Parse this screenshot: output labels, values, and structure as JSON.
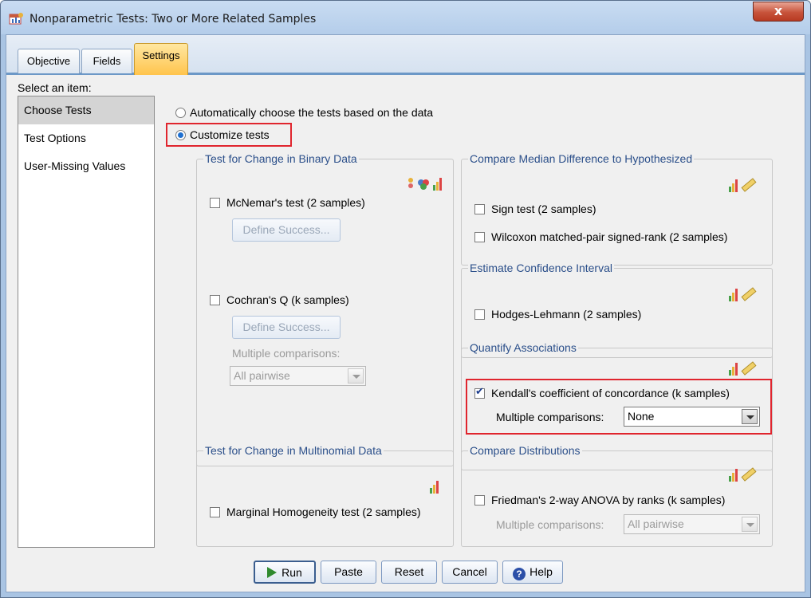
{
  "window": {
    "title": "Nonparametric Tests: Two or More Related Samples",
    "close_label": "x"
  },
  "tabs": [
    {
      "label": "Objective"
    },
    {
      "label": "Fields"
    },
    {
      "label": "Settings"
    }
  ],
  "sidebar": {
    "label": "Select an item:",
    "items": [
      {
        "label": "Choose Tests"
      },
      {
        "label": "Test Options"
      },
      {
        "label": "User-Missing Values"
      }
    ]
  },
  "mode": {
    "auto_label": "Automatically choose the tests based on the data",
    "custom_label": "Customize tests",
    "selected": "custom"
  },
  "binary": {
    "title": "Test for Change in Binary Data",
    "mcnemar": "McNemar's test (2 samples)",
    "define_success_1": "Define Success...",
    "cochran": "Cochran's Q (k samples)",
    "define_success_2": "Define Success...",
    "multiple_label": "Multiple comparisons:",
    "multiple_value": "All pairwise"
  },
  "multinomial": {
    "title": "Test for Change in Multinomial Data",
    "marginal": "Marginal Homogeneity test (2 samples)"
  },
  "median": {
    "title": "Compare Median Difference to Hypothesized",
    "sign": "Sign test (2 samples)",
    "wilcoxon": "Wilcoxon matched-pair signed-rank (2 samples)"
  },
  "ci": {
    "title": "Estimate Confidence Interval",
    "hodges": "Hodges-Lehmann (2 samples)"
  },
  "assoc": {
    "title": "Quantify Associations",
    "kendall": "Kendall's coefficient of concordance (k samples)",
    "kendall_checked": true,
    "multiple_label": "Multiple comparisons:",
    "multiple_value": "None"
  },
  "dist": {
    "title": "Compare Distributions",
    "friedman": "Friedman's 2-way ANOVA by ranks (k samples)",
    "multiple_label": "Multiple comparisons:",
    "multiple_value": "All pairwise"
  },
  "buttons": {
    "run": "Run",
    "paste": "Paste",
    "reset": "Reset",
    "cancel": "Cancel",
    "help": "Help"
  },
  "colors": {
    "highlight_border": "#e0252e",
    "active_tab": "#ffc44c",
    "group_title": "#2b4f8a"
  }
}
